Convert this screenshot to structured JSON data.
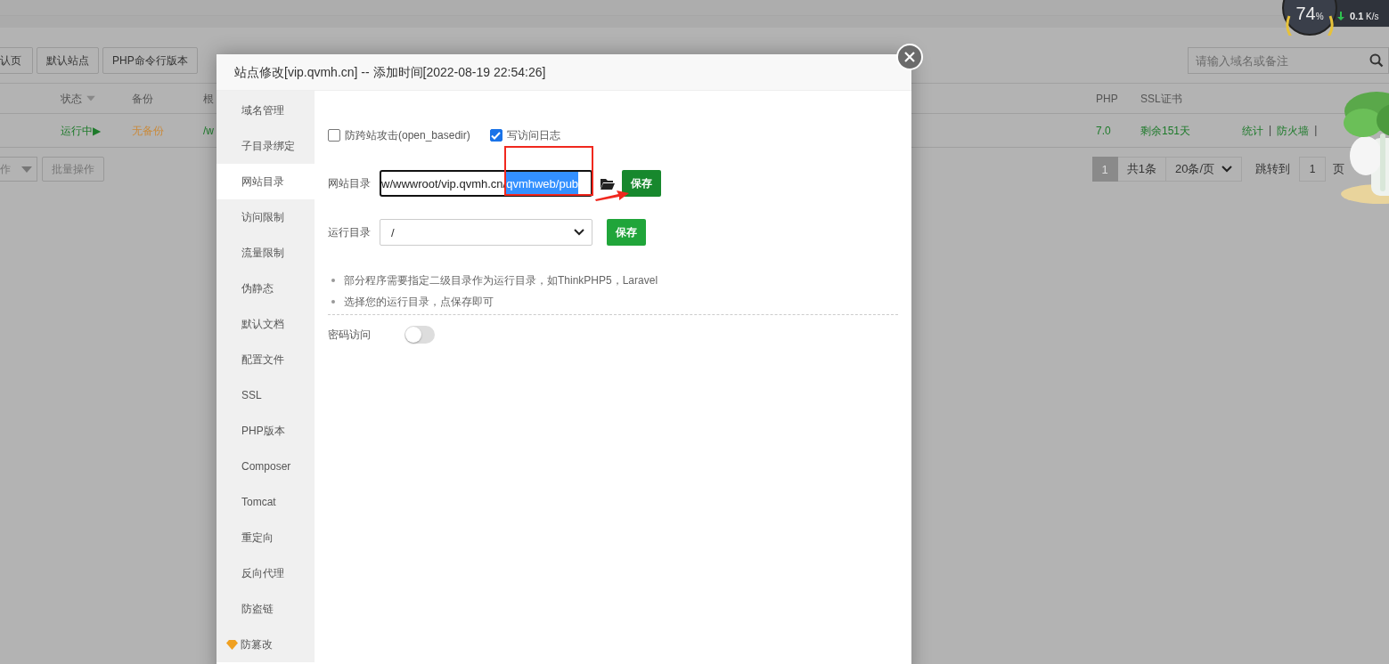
{
  "gauge": {
    "percent": "74",
    "unit": "%",
    "download": {
      "value": "0.1",
      "unit": "K/s"
    }
  },
  "toolbar": {
    "buttons": [
      "认页",
      "默认站点",
      "PHP命令行版本"
    ]
  },
  "search": {
    "placeholder": "请输入域名或备注"
  },
  "table": {
    "columns": [
      {
        "label": "状态",
        "sorted": true
      },
      {
        "label": "备份",
        "sorted": false
      },
      {
        "label": "根",
        "sorted": false
      },
      {
        "label": "PHP",
        "sorted": false
      },
      {
        "label": "SSL证书",
        "sorted": false
      }
    ],
    "rows": [
      {
        "status": "运行中▶",
        "backup": "无备份",
        "root": "/w",
        "php": "7.0",
        "ssl": "剩余151天",
        "actions": [
          {
            "kind": "link",
            "label": "统计"
          },
          {
            "kind": "sep",
            "label": "|"
          },
          {
            "kind": "link",
            "label": "防火墙"
          },
          {
            "kind": "sep",
            "label": "|"
          }
        ]
      }
    ]
  },
  "bulk": {
    "select": "作",
    "button": "批量操作"
  },
  "pagination": {
    "pages": [
      {
        "label": "1",
        "selected": true
      }
    ],
    "total": "共1条",
    "per_page": "20条/页",
    "jump_label": "跳转到",
    "jump_value": "1",
    "page_unit": "页"
  },
  "dialog": {
    "title": "站点修改[vip.qvmh.cn] -- 添加时间[2022-08-19 22:54:26]",
    "tabs": [
      {
        "label": "域名管理",
        "selected": false,
        "premium": false
      },
      {
        "label": "子目录绑定",
        "selected": false,
        "premium": false
      },
      {
        "label": "网站目录",
        "selected": true,
        "premium": false
      },
      {
        "label": "访问限制",
        "selected": false,
        "premium": false
      },
      {
        "label": "流量限制",
        "selected": false,
        "premium": false
      },
      {
        "label": "伪静态",
        "selected": false,
        "premium": false
      },
      {
        "label": "默认文档",
        "selected": false,
        "premium": false
      },
      {
        "label": "配置文件",
        "selected": false,
        "premium": false
      },
      {
        "label": "SSL",
        "selected": false,
        "premium": false
      },
      {
        "label": "PHP版本",
        "selected": false,
        "premium": false
      },
      {
        "label": "Composer",
        "selected": false,
        "premium": false
      },
      {
        "label": "Tomcat",
        "selected": false,
        "premium": false
      },
      {
        "label": "重定向",
        "selected": false,
        "premium": false
      },
      {
        "label": "反向代理",
        "selected": false,
        "premium": false
      },
      {
        "label": "防盗链",
        "selected": false,
        "premium": false
      },
      {
        "label": "防篡改",
        "selected": false,
        "premium": true
      }
    ],
    "checkboxes": [
      {
        "label": "防跨站攻击(open_basedir)",
        "checked": false
      },
      {
        "label": "写访问日志",
        "checked": true
      }
    ],
    "site_dir": {
      "label": "网站目录",
      "value": "w/wwwroot/vip.qvmh.cn/",
      "selected_text": "qvmhweb/pub",
      "button": "保存",
      "highlighted": true
    },
    "run_dir": {
      "label": "运行目录",
      "value": "/",
      "button": "保存"
    },
    "notes": [
      "部分程序需要指定二级目录作为运行目录，如ThinkPHP5，Laravel",
      "选择您的运行目录，点保存即可"
    ],
    "password_access": {
      "label": "密码访问",
      "on": false
    }
  }
}
